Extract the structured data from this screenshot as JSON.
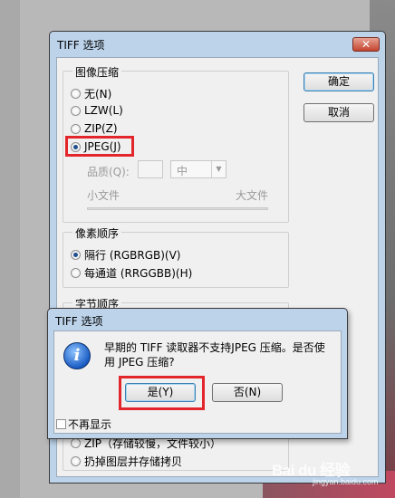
{
  "main_window": {
    "title": "TIFF 选项",
    "close_label": "✕",
    "ok_label": "确定",
    "cancel_label": "取消",
    "compression": {
      "legend": "图像压缩",
      "options": [
        "无(N)",
        "LZW(L)",
        "ZIP(Z)",
        "JPEG(J)"
      ],
      "selected": "JPEG(J)",
      "quality_label": "品质(Q):",
      "quality_value": "中",
      "slider_min_label": "小文件",
      "slider_max_label": "大文件"
    },
    "pixel_order": {
      "legend": "像素顺序",
      "options": [
        "隔行 (RGBRGB)(V)",
        "每通道 (RRGGBB)(H)"
      ],
      "selected": "隔行 (RGBRGB)(V)"
    },
    "byte_order": {
      "legend": "字节顺序"
    },
    "layer_options": {
      "options": [
        "ZIP（存储较慢，文件较小）",
        "扔掉图层并存储拷贝"
      ]
    }
  },
  "message_dialog": {
    "title": "TIFF 选项",
    "icon": "info-icon",
    "message": "早期的 TIFF 读取器不支持JPEG 压缩。是否使用 JPEG 压缩?",
    "yes_label": "是(Y)",
    "no_label": "否(N)",
    "dont_show_label": "不再显示"
  },
  "highlight_color": "#e3262c",
  "watermark": {
    "text": "Bai du 经验",
    "sub": "jingyan.baidu.com"
  }
}
